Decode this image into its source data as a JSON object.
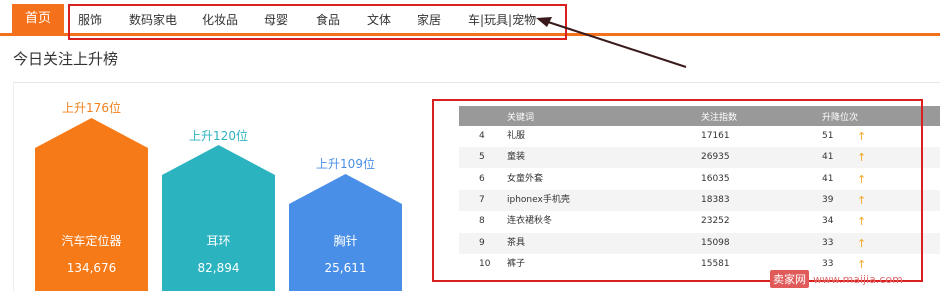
{
  "nav": {
    "home": "首页",
    "items": [
      "服饰",
      "数码家电",
      "化妆品",
      "母婴",
      "食品",
      "文体",
      "家居",
      "车|玩具|宠物"
    ]
  },
  "section_title": "今日关注上升榜",
  "top3": [
    {
      "rise": "上升176位",
      "name": "汽车定位器",
      "value": "134,676",
      "color": "#f77a18",
      "label_color": "#f0801e"
    },
    {
      "rise": "上升120位",
      "name": "耳环",
      "value": "82,894",
      "color": "#2bb3c0",
      "label_color": "#2bb3c0"
    },
    {
      "rise": "上升109位",
      "name": "胸针",
      "value": "25,611",
      "color": "#4a8fe7",
      "label_color": "#4a8fe7"
    }
  ],
  "table": {
    "headers": [
      "",
      "关键词",
      "关注指数",
      "升降位次"
    ],
    "rows": [
      {
        "rank": "4",
        "keyword": "礼服",
        "index": "17161",
        "change": "51"
      },
      {
        "rank": "5",
        "keyword": "童装",
        "index": "26935",
        "change": "41"
      },
      {
        "rank": "6",
        "keyword": "女童外套",
        "index": "16035",
        "change": "41"
      },
      {
        "rank": "7",
        "keyword": "iphonex手机壳",
        "index": "18383",
        "change": "39"
      },
      {
        "rank": "8",
        "keyword": "连衣裙秋冬",
        "index": "23252",
        "change": "34"
      },
      {
        "rank": "9",
        "keyword": "茶具",
        "index": "15098",
        "change": "33"
      },
      {
        "rank": "10",
        "keyword": "裤子",
        "index": "15581",
        "change": "33"
      }
    ]
  },
  "watermark": {
    "badge": "卖家网",
    "url": "www.maijia.com"
  },
  "colors": {
    "accent": "#f5701a",
    "annotation": "#d9201e"
  },
  "icons": {
    "rise": "arrow-up-icon"
  }
}
